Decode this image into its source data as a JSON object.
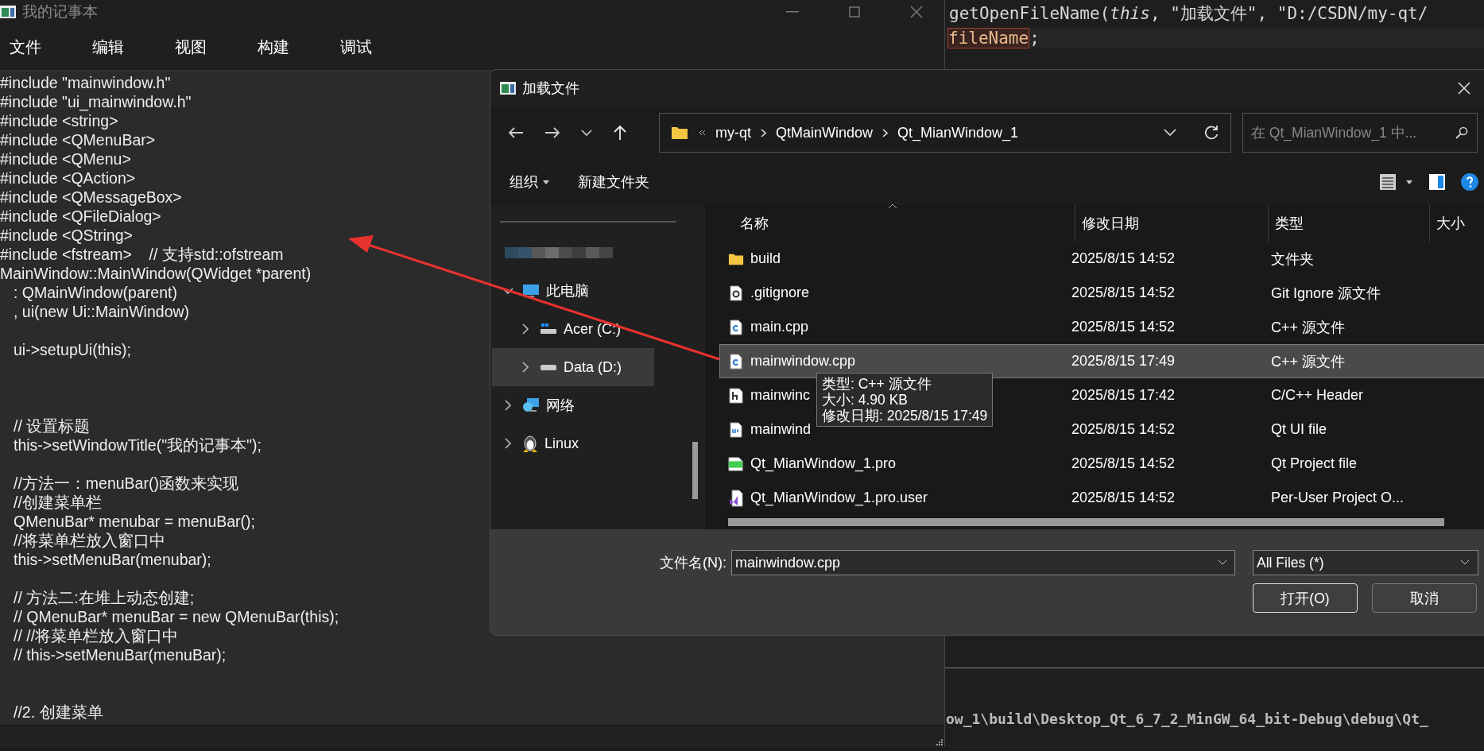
{
  "ide": {
    "code_top": [
      {
        "parts": [
          {
            "text": "getOpenFileName(*this*, \"加载文件\", \"D:/CSDN/my-qt/",
            "highlighted": false
          }
        ]
      },
      {
        "parts": [
          {
            "text": "fileName",
            "highlighted": true
          },
          {
            "text": ";",
            "highlighted": false
          }
        ]
      }
    ],
    "output_line": "ow_1\\build\\Desktop_Qt_6_7_2_MinGW_64_bit-Debug\\debug\\Qt_"
  },
  "notepad": {
    "title": "我的记事本",
    "menu": [
      "文件",
      "编辑",
      "视图",
      "构建",
      "调试"
    ],
    "lines": [
      {
        "kind": "code",
        "text": "#include \"mainwindow.h\"",
        "indent": false
      },
      {
        "kind": "code",
        "text": "#include \"ui_mainwindow.h\"",
        "indent": false
      },
      {
        "kind": "code",
        "text": "#include <string>",
        "indent": false
      },
      {
        "kind": "code",
        "text": "#include <QMenuBar>",
        "indent": false
      },
      {
        "kind": "code",
        "text": "#include <QMenu>",
        "indent": false
      },
      {
        "kind": "code",
        "text": "#include <QAction>",
        "indent": false
      },
      {
        "kind": "code",
        "text": "#include <QMessageBox>",
        "indent": false
      },
      {
        "kind": "code",
        "text": "#include <QFileDialog>",
        "indent": false
      },
      {
        "kind": "code",
        "text": "#include <QString>",
        "indent": false
      },
      {
        "kind": "code",
        "text": "#include <fstream>    // 支持std::ofstream",
        "indent": false
      },
      {
        "kind": "code",
        "text": "MainWindow::MainWindow(QWidget *parent)",
        "indent": false
      },
      {
        "kind": "code",
        "text": ": QMainWindow(parent)",
        "indent": true
      },
      {
        "kind": "code",
        "text": ", ui(new Ui::MainWindow)",
        "indent": true
      },
      {
        "kind": "blank"
      },
      {
        "kind": "code",
        "text": "ui->setupUi(this);",
        "indent": true
      },
      {
        "kind": "blank"
      },
      {
        "kind": "blank"
      },
      {
        "kind": "blank"
      },
      {
        "kind": "code",
        "text": "// 设置标题",
        "indent": true
      },
      {
        "kind": "code",
        "text": "this->setWindowTitle(\"我的记事本\");",
        "indent": true
      },
      {
        "kind": "blank"
      },
      {
        "kind": "code",
        "text": "//方法一：menuBar()函数来实现",
        "indent": true
      },
      {
        "kind": "code",
        "text": "//创建菜单栏",
        "indent": true
      },
      {
        "kind": "code",
        "text": "QMenuBar* menubar = menuBar();",
        "indent": true
      },
      {
        "kind": "code",
        "text": "//将菜单栏放入窗口中",
        "indent": true
      },
      {
        "kind": "code",
        "text": "this->setMenuBar(menubar);",
        "indent": true
      },
      {
        "kind": "blank"
      },
      {
        "kind": "code",
        "text": "// 方法二:在堆上动态创建;",
        "indent": true
      },
      {
        "kind": "code",
        "text": "// QMenuBar* menuBar = new QMenuBar(this);",
        "indent": true
      },
      {
        "kind": "code",
        "text": "// //将菜单栏放入窗口中",
        "indent": true
      },
      {
        "kind": "code",
        "text": "// this->setMenuBar(menuBar);",
        "indent": true
      },
      {
        "kind": "blank"
      },
      {
        "kind": "blank"
      },
      {
        "kind": "code",
        "text": "//2. 创建菜单",
        "indent": true
      }
    ]
  },
  "dialog": {
    "title": "加载文件",
    "breadcrumb": [
      "my-qt",
      "QtMainWindow",
      "Qt_MianWindow_1"
    ],
    "search": {
      "placeholder": "在 Qt_MianWindow_1 中..."
    },
    "toolbar": {
      "organize": "组织",
      "new_folder": "新建文件夹"
    },
    "nav": [
      {
        "kind": "blurred"
      },
      {
        "kind": "pc",
        "label": "此电脑",
        "expanded": true,
        "selected": false,
        "children": [
          {
            "kind": "drive-c",
            "label": "Acer (C:)",
            "expanded": false,
            "selected": false
          },
          {
            "kind": "drive-d",
            "label": "Data (D:)",
            "expanded": false,
            "selected": true
          }
        ]
      },
      {
        "kind": "network",
        "label": "网络",
        "expanded": false,
        "selected": false
      },
      {
        "kind": "linux",
        "label": "Linux",
        "expanded": false,
        "selected": false
      }
    ],
    "columns": [
      "名称",
      "修改日期",
      "类型",
      "大小"
    ],
    "files": [
      {
        "kind": "folder",
        "name": "build",
        "date": "2025/8/15 14:52",
        "type": "文件夹",
        "selected": false
      },
      {
        "kind": "config",
        "name": ".gitignore",
        "date": "2025/8/15 14:52",
        "type": "Git Ignore 源文件",
        "selected": false
      },
      {
        "kind": "cpp",
        "name": "main.cpp",
        "date": "2025/8/15 14:52",
        "type": "C++ 源文件",
        "selected": false
      },
      {
        "kind": "cpp",
        "name": "mainwindow.cpp",
        "date": "2025/8/15 17:49",
        "type": "C++ 源文件",
        "selected": true
      },
      {
        "kind": "header",
        "name": "mainwinc",
        "date": "2025/8/15 17:42",
        "type": "C/C++ Header",
        "selected": false
      },
      {
        "kind": "ui",
        "name": "mainwind",
        "date": "2025/8/15 14:52",
        "type": "Qt UI file",
        "selected": false
      },
      {
        "kind": "pro",
        "name": "Qt_MianWindow_1.pro",
        "date": "2025/8/15 14:52",
        "type": "Qt Project file",
        "selected": false
      },
      {
        "kind": "user",
        "name": "Qt_MianWindow_1.pro.user",
        "date": "2025/8/15 14:52",
        "type": "Per-User Project O...",
        "selected": false
      }
    ],
    "tooltip": [
      "类型: C++ 源文件",
      "大小: 4.90 KB",
      "修改日期: 2025/8/15 17:49"
    ],
    "filename_label": "文件名(N):",
    "filename": "mainwindow.cpp",
    "filter": "All Files (*)",
    "buttons": [
      "打开(O)",
      "取消"
    ]
  }
}
